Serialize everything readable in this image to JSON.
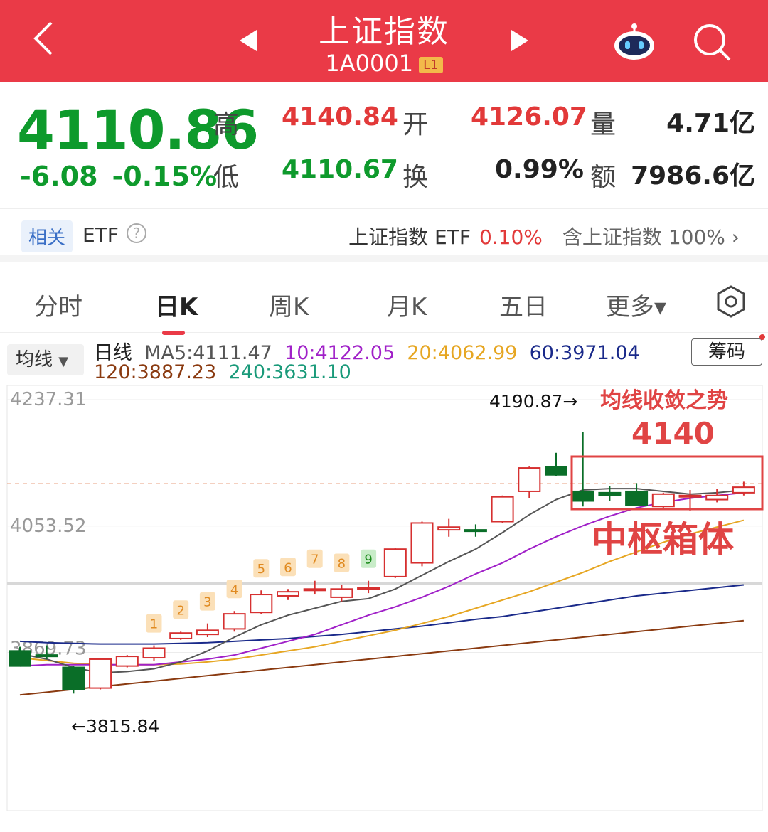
{
  "header": {
    "title": "上证指数",
    "code": "1A0001",
    "level": "L1",
    "back_icon": "chevron-left-icon",
    "prev_icon": "triangle-left-icon",
    "next_icon": "triangle-right-icon",
    "robot_icon": "robot-assistant-icon",
    "search_icon": "search-icon",
    "bg_color": "#ea3a47"
  },
  "quote": {
    "price": "4110.86",
    "change": "-6.08",
    "change_pct": "-0.15%",
    "high_label": "高",
    "high": "4140.84",
    "low_label": "低",
    "low": "4110.67",
    "open_label": "开",
    "open": "4126.07",
    "turnover_label": "换",
    "turnover": "0.99%",
    "volume_label": "量",
    "volume": "4.71亿",
    "amount_label": "额",
    "amount": "7986.6亿"
  },
  "etf": {
    "tag": "相关",
    "label": "ETF",
    "help": "?",
    "name": "上证指数 ETF",
    "pct": "0.10%",
    "contain": "含上证指数",
    "contain_pct": "100%",
    "chevron": "›"
  },
  "tabs": [
    {
      "label": "分时"
    },
    {
      "label": "日K"
    },
    {
      "label": "周K"
    },
    {
      "label": "月K"
    },
    {
      "label": "五日"
    },
    {
      "label": "更多▾"
    }
  ],
  "ma": {
    "selector": "均线",
    "period": "日线",
    "ma5": "MA5:4111.47",
    "ma10": "10:4122.05",
    "ma20": "20:4062.99",
    "ma60": "60:3971.04",
    "ma120": "120:3887.23",
    "ma240": "240:3631.10",
    "chip_button": "筹码",
    "colors": {
      "ma5": "#555555",
      "ma10": "#a020c8",
      "ma20": "#e6a622",
      "ma60": "#1a2a8a",
      "ma120": "#8a3a10",
      "ma240": "#1a9a7a"
    }
  },
  "chart_data": {
    "type": "candlestick",
    "yaxis_labels": [
      "4237.31",
      "4053.52",
      "3869.73"
    ],
    "ylim": [
      3800,
      4237.31
    ],
    "annotations": {
      "high_mark": "4190.87→",
      "low_mark": "←3815.84",
      "trend_text": "均线收敛之势",
      "level_text": "4140",
      "box_text": "中枢箱体"
    },
    "count_labels": [
      "1",
      "2",
      "3",
      "4",
      "5",
      "6",
      "7",
      "8",
      "9"
    ],
    "candles": [
      {
        "o": 3872,
        "h": 3878,
        "l": 3854,
        "c": 3850
      },
      {
        "o": 3866,
        "h": 3880,
        "l": 3860,
        "c": 3864
      },
      {
        "o": 3848,
        "h": 3850,
        "l": 3810,
        "c": 3816
      },
      {
        "o": 3818,
        "h": 3862,
        "l": 3816,
        "c": 3860
      },
      {
        "o": 3850,
        "h": 3866,
        "l": 3848,
        "c": 3864
      },
      {
        "o": 3862,
        "h": 3880,
        "l": 3858,
        "c": 3876
      },
      {
        "o": 3890,
        "h": 3900,
        "l": 3888,
        "c": 3898
      },
      {
        "o": 3896,
        "h": 3912,
        "l": 3892,
        "c": 3902
      },
      {
        "o": 3904,
        "h": 3930,
        "l": 3900,
        "c": 3926
      },
      {
        "o": 3928,
        "h": 3960,
        "l": 3926,
        "c": 3954
      },
      {
        "o": 3952,
        "h": 3962,
        "l": 3946,
        "c": 3958
      },
      {
        "o": 3960,
        "h": 3974,
        "l": 3954,
        "c": 3962
      },
      {
        "o": 3950,
        "h": 3968,
        "l": 3944,
        "c": 3962
      },
      {
        "o": 3962,
        "h": 3974,
        "l": 3956,
        "c": 3964
      },
      {
        "o": 3980,
        "h": 4022,
        "l": 3978,
        "c": 4020
      },
      {
        "o": 4000,
        "h": 4060,
        "l": 3995,
        "c": 4058
      },
      {
        "o": 4048,
        "h": 4064,
        "l": 4038,
        "c": 4052
      },
      {
        "o": 4048,
        "h": 4056,
        "l": 4038,
        "c": 4046
      },
      {
        "o": 4060,
        "h": 4098,
        "l": 4058,
        "c": 4096
      },
      {
        "o": 4104,
        "h": 4140,
        "l": 4094,
        "c": 4138
      },
      {
        "o": 4140,
        "h": 4160,
        "l": 4126,
        "c": 4128
      },
      {
        "o": 4104,
        "h": 4190,
        "l": 4082,
        "c": 4090
      },
      {
        "o": 4102,
        "h": 4112,
        "l": 4090,
        "c": 4098
      },
      {
        "o": 4104,
        "h": 4116,
        "l": 4088,
        "c": 4084
      },
      {
        "o": 4082,
        "h": 4102,
        "l": 4080,
        "c": 4100
      },
      {
        "o": 4098,
        "h": 4106,
        "l": 4076,
        "c": 4098
      },
      {
        "o": 4092,
        "h": 4108,
        "l": 4088,
        "c": 4098
      },
      {
        "o": 4102,
        "h": 4118,
        "l": 4098,
        "c": 4110
      }
    ],
    "ma5": [
      3868,
      3860,
      3848,
      3840,
      3842,
      3846,
      3856,
      3872,
      3892,
      3910,
      3924,
      3934,
      3944,
      3948,
      3962,
      3982,
      4002,
      4020,
      4044,
      4070,
      4092,
      4106,
      4108,
      4108,
      4104,
      4100,
      4102,
      4106
    ],
    "ma10": [
      3850,
      3852,
      3852,
      3852,
      3852,
      3852,
      3856,
      3860,
      3866,
      3876,
      3886,
      3896,
      3910,
      3924,
      3936,
      3950,
      3966,
      3984,
      4000,
      4020,
      4038,
      4054,
      4068,
      4080,
      4088,
      4094,
      4098,
      4102
    ],
    "ma20": [
      3862,
      3858,
      3854,
      3852,
      3852,
      3852,
      3853,
      3856,
      3860,
      3866,
      3872,
      3878,
      3886,
      3894,
      3902,
      3912,
      3922,
      3934,
      3946,
      3958,
      3972,
      3986,
      4002,
      4016,
      4030,
      4042,
      4052,
      4062
    ],
    "ma60": [
      3886,
      3884,
      3883,
      3882,
      3882,
      3882,
      3883,
      3884,
      3886,
      3888,
      3890,
      3893,
      3896,
      3900,
      3904,
      3908,
      3913,
      3918,
      3922,
      3928,
      3934,
      3940,
      3946,
      3952,
      3956,
      3960,
      3964,
      3968
    ],
    "ma120": [
      3808,
      3812,
      3816,
      3820,
      3824,
      3828,
      3832,
      3836,
      3840,
      3844,
      3848,
      3852,
      3856,
      3860,
      3864,
      3868,
      3872,
      3876,
      3880,
      3884,
      3888,
      3892,
      3896,
      3900,
      3904,
      3908,
      3912,
      3916
    ]
  }
}
